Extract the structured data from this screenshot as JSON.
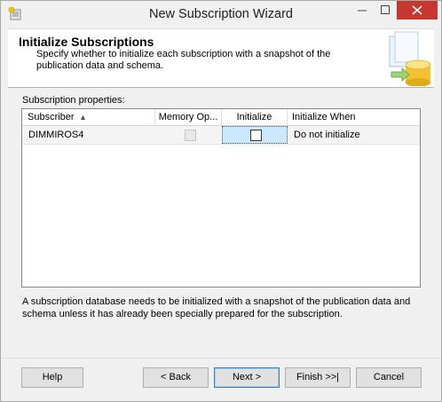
{
  "window": {
    "title": "New Subscription Wizard",
    "controls": {
      "minimize": "–",
      "maximize": "☐",
      "close": "✕"
    }
  },
  "header": {
    "title": "Initialize Subscriptions",
    "description": "Specify whether to initialize each subscription with a snapshot of the publication data and schema."
  },
  "subscription_properties": {
    "label": "Subscription properties:",
    "columns": [
      "Subscriber",
      "Memory Op...",
      "Initialize",
      "Initialize When"
    ],
    "sort_indicator": "▲",
    "rows": [
      {
        "subscriber": "DIMMIROS4",
        "memory_optimized": false,
        "initialize": false,
        "initialize_when": "Do not initialize"
      }
    ]
  },
  "info_text": "A subscription database needs to be initialized with a snapshot of the publication data and schema unless it has already been specially prepared for the subscription.",
  "buttons": {
    "help": "Help",
    "back": "< Back",
    "next": "Next >",
    "finish": "Finish >>|",
    "cancel": "Cancel"
  }
}
